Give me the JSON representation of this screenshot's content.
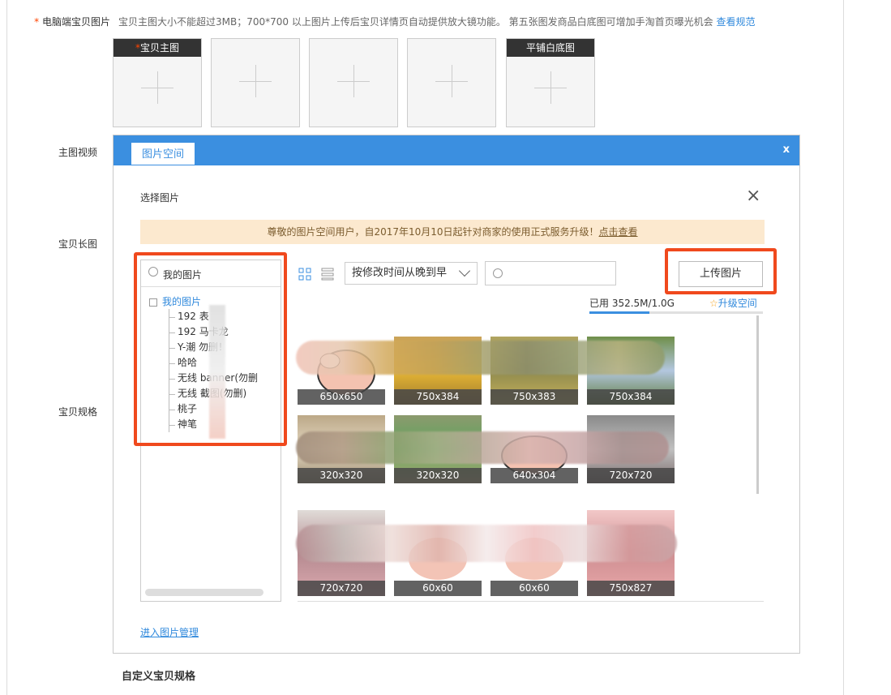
{
  "form": {
    "pc_images_label": "电脑端宝贝图片",
    "required_mark": "*",
    "hint": "宝贝主图大小不能超过3MB；700*700 以上图片上传后宝贝详情页自动提供放大镜功能。 第五张图发商品白底图可增加手淘首页曝光机会",
    "hint_link": "查看规范",
    "slots": [
      {
        "caption": "宝贝主图",
        "required": true
      },
      {
        "caption": "",
        "required": false
      },
      {
        "caption": "",
        "required": false
      },
      {
        "caption": "",
        "required": false
      },
      {
        "caption": "平铺白底图",
        "required": false
      }
    ],
    "main_video_label": "主图视频",
    "long_image_label": "宝贝长图",
    "spec_label": "宝贝规格",
    "custom_spec_label": "自定义宝贝规格"
  },
  "dialog": {
    "tab": "图片空间",
    "close": "x",
    "select_title": "选择图片",
    "close_icon": "×",
    "notice": "尊敬的图片空间用户，自2017年10月10日起针对商家的使用正式服务升级！",
    "notice_link": "点击查看",
    "tree_search": "我的图片",
    "tree_root": "我的图片",
    "tree_items": [
      "192    表",
      "192     马卡龙",
      "Y-潮    勿删！",
      "哈哈",
      "无线     banner(勿删",
      "无线     截图(勿删)",
      "桃子",
      "神笔"
    ],
    "sort": "按修改时间从晚到早",
    "upload": "上传图片",
    "usage": "已用 352.5M/1.0G",
    "upgrade": "升级空间",
    "upgrade_icon": "☆",
    "quota_used_fraction": 0.344,
    "images": [
      "650x650",
      "750x384",
      "750x383",
      "750x384",
      "320x320",
      "320x320",
      "640x304",
      "720x720",
      "720x720",
      "60x60",
      "60x60",
      "750x827"
    ],
    "manage_link": "进入图片管理"
  }
}
